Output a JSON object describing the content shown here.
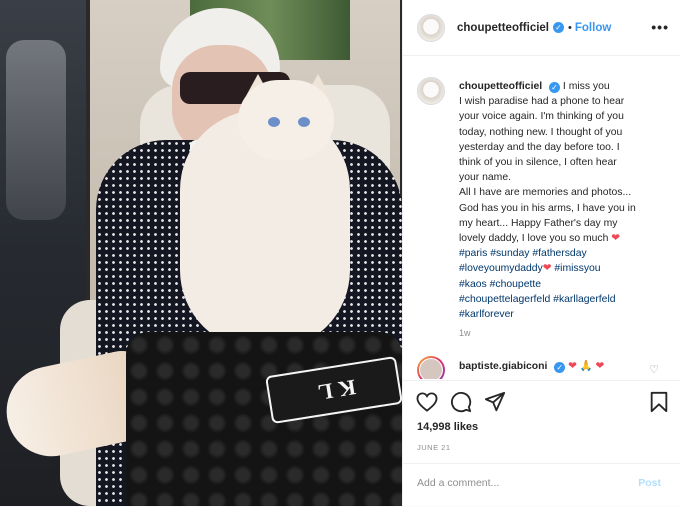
{
  "header": {
    "username": "choupetteofficiel",
    "follow_label": "Follow",
    "dot": "•",
    "more": "•••"
  },
  "caption": {
    "username": "choupetteofficiel",
    "lines": [
      "I miss you",
      "I wish paradise had a phone to hear",
      "your voice again. I'm thinking of you",
      "today, nothing new. I thought of you",
      "yesterday and the day before too. I",
      "think of you in silence, I often hear",
      "your name.",
      "All I have are memories and photos...",
      "God has you in his arms, I have you in",
      "my heart... Happy Father's day my",
      "lovely daddy, I love you so much"
    ],
    "hashtags": {
      "line1": [
        "#paris",
        "#sunday",
        "#fathersday"
      ],
      "line2a": "#loveyoumydaddy",
      "line2b": "#imissyou",
      "line3": [
        "#kaos",
        "#choupette"
      ],
      "line4": [
        "#choupettelagerfeld",
        "#karllagerfeld"
      ],
      "line5": [
        "#karlforever"
      ]
    },
    "heart": "❤",
    "time_ago": "1w"
  },
  "comment": {
    "username": "baptiste.giabiconi",
    "emojis": "❤ 🙏 ❤",
    "like_icon": "♡"
  },
  "actions": {
    "likes": "14,998 likes",
    "date": "JUNE 21"
  },
  "add_comment": {
    "placeholder": "Add a comment...",
    "post_label": "Post"
  },
  "photo": {
    "phone_case_text": "KL"
  },
  "colors": {
    "accent": "#3897f0",
    "hashtag": "#00376b",
    "heart": "#ed4956",
    "post_disabled": "#b2dffc"
  }
}
